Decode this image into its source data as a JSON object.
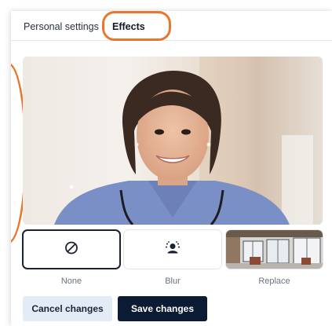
{
  "tabs": [
    {
      "label": "Personal settings"
    },
    {
      "label": "Effects",
      "active": true
    }
  ],
  "effects": [
    {
      "label": "None",
      "icon": "none-icon",
      "selected": true
    },
    {
      "label": "Blur",
      "icon": "blur-icon"
    },
    {
      "label": "Replace",
      "icon": "background-image"
    }
  ],
  "buttons": {
    "cancel": "Cancel changes",
    "save": "Save changes"
  },
  "colors": {
    "highlight": "#e8762d",
    "save_bg": "#0b1b33",
    "cancel_bg": "#e3ebf7",
    "selected_border": "#1a2233"
  }
}
